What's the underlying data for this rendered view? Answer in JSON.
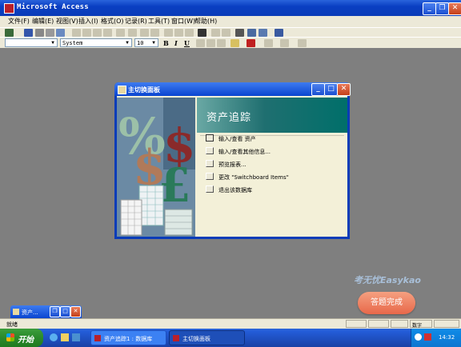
{
  "app": {
    "title": "Microsoft Access"
  },
  "menu": [
    "文件(F)",
    "编辑(E)",
    "视图(V)",
    "插入(I)",
    "格式(O)",
    "记录(R)",
    "工具(T)",
    "窗口(W)",
    "帮助(H)"
  ],
  "format_toolbar": {
    "object_combo": "",
    "font_combo": "System",
    "size_combo": "10",
    "bold": "B",
    "italic": "I",
    "underline": "U"
  },
  "switchboard": {
    "window_title": "主切换面板",
    "heading": "资产追踪",
    "options": [
      "输入/查看 资产",
      "输入/查看其他信息...",
      "预览报表...",
      "更改 \"Switchboard Items\"",
      "退出该数据库"
    ]
  },
  "minimized_window": {
    "title": "资产..."
  },
  "status_bar": {
    "left": "就绪",
    "num": "数字"
  },
  "taskbar": {
    "start": "开始",
    "buttons": [
      "资产追踪1 : 数据库",
      "主切换面板"
    ],
    "clock": "14:32"
  },
  "watermark": "考无忧Easykao",
  "done_button": "答题完成",
  "colors": {
    "accent": "#0a3cb8",
    "teal": "#006f6a",
    "done": "#e8684a"
  }
}
